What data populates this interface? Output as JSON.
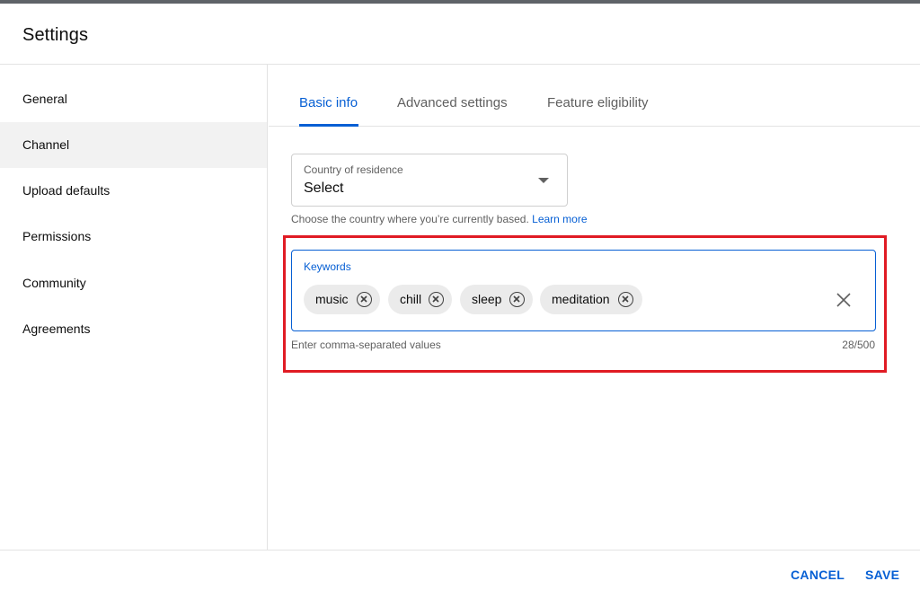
{
  "header": {
    "title": "Settings"
  },
  "sidebar": {
    "items": [
      {
        "label": "General"
      },
      {
        "label": "Channel"
      },
      {
        "label": "Upload defaults"
      },
      {
        "label": "Permissions"
      },
      {
        "label": "Community"
      },
      {
        "label": "Agreements"
      }
    ],
    "active": "Channel"
  },
  "tabs": [
    {
      "label": "Basic info"
    },
    {
      "label": "Advanced settings"
    },
    {
      "label": "Feature eligibility"
    }
  ],
  "country": {
    "label": "Country of residence",
    "value": "Select",
    "icon": "dropdown-arrow-icon",
    "helper": "Choose the country where you’re currently based.",
    "learn_more": "Learn more"
  },
  "keywords": {
    "label": "Keywords",
    "chips": [
      {
        "text": "music"
      },
      {
        "text": "chill"
      },
      {
        "text": "sleep"
      },
      {
        "text": "meditation"
      }
    ],
    "helper": "Enter comma-separated values",
    "count": "28/500"
  },
  "footer": {
    "cancel": "CANCEL",
    "save": "SAVE"
  },
  "colors": {
    "accent": "#065fd4",
    "highlight": "#e01b24",
    "chip_bg": "#ebebeb",
    "active_nav_bg": "#f2f2f2"
  }
}
